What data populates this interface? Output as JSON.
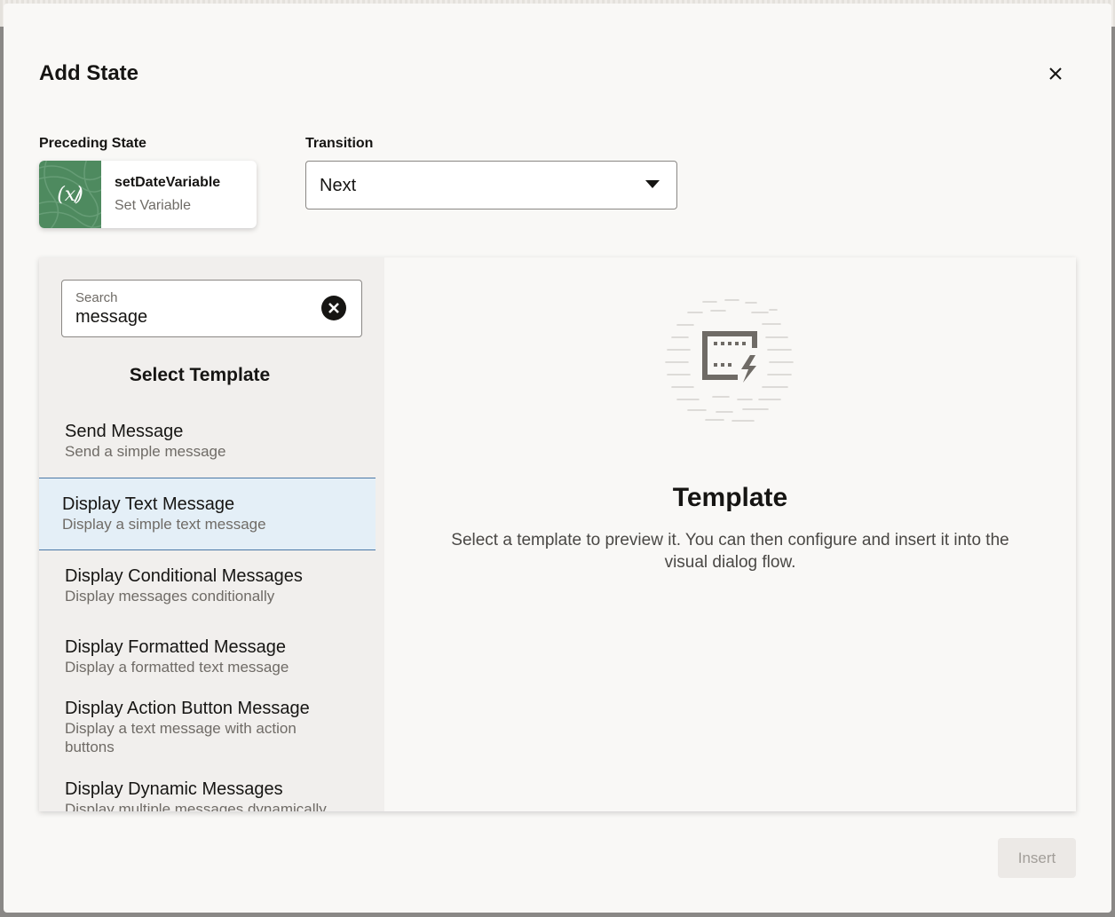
{
  "dialog": {
    "title": "Add State",
    "close_icon": "close-icon"
  },
  "preceding_state": {
    "label": "Preceding State",
    "name": "setDateVariable",
    "type": "Set Variable",
    "icon": "set-variable-icon",
    "icon_color": "#4e8a5f"
  },
  "transition": {
    "label": "Transition",
    "value": "Next",
    "icon": "caret-down-icon"
  },
  "search": {
    "label": "Search",
    "value": "message",
    "clear_icon": "clear-icon"
  },
  "templates": {
    "heading": "Select Template",
    "items": [
      {
        "title": "Send Message",
        "desc": "Send a simple message",
        "selected": false
      },
      {
        "title": "Display Text Message",
        "desc": "Display a simple text message",
        "selected": true
      },
      {
        "title": "Display Conditional Messages",
        "desc": "Display messages conditionally",
        "selected": false
      },
      {
        "title": "Display Formatted Message",
        "desc": "Display a formatted text message",
        "selected": false
      },
      {
        "title": "Display Action Button Message",
        "desc": "Display a text message with action buttons",
        "selected": false
      },
      {
        "title": "Display Dynamic Messages",
        "desc": "Display multiple messages dynamically",
        "selected": false
      }
    ]
  },
  "preview": {
    "illustration": "template-illustration-icon",
    "title": "Template",
    "description": "Select a template to preview it. You can then configure and insert it into the visual dialog flow."
  },
  "footer": {
    "insert_label": "Insert",
    "insert_enabled": false
  },
  "colors": {
    "selected_bg": "#e4eff7",
    "selected_border": "#4a78a6"
  }
}
